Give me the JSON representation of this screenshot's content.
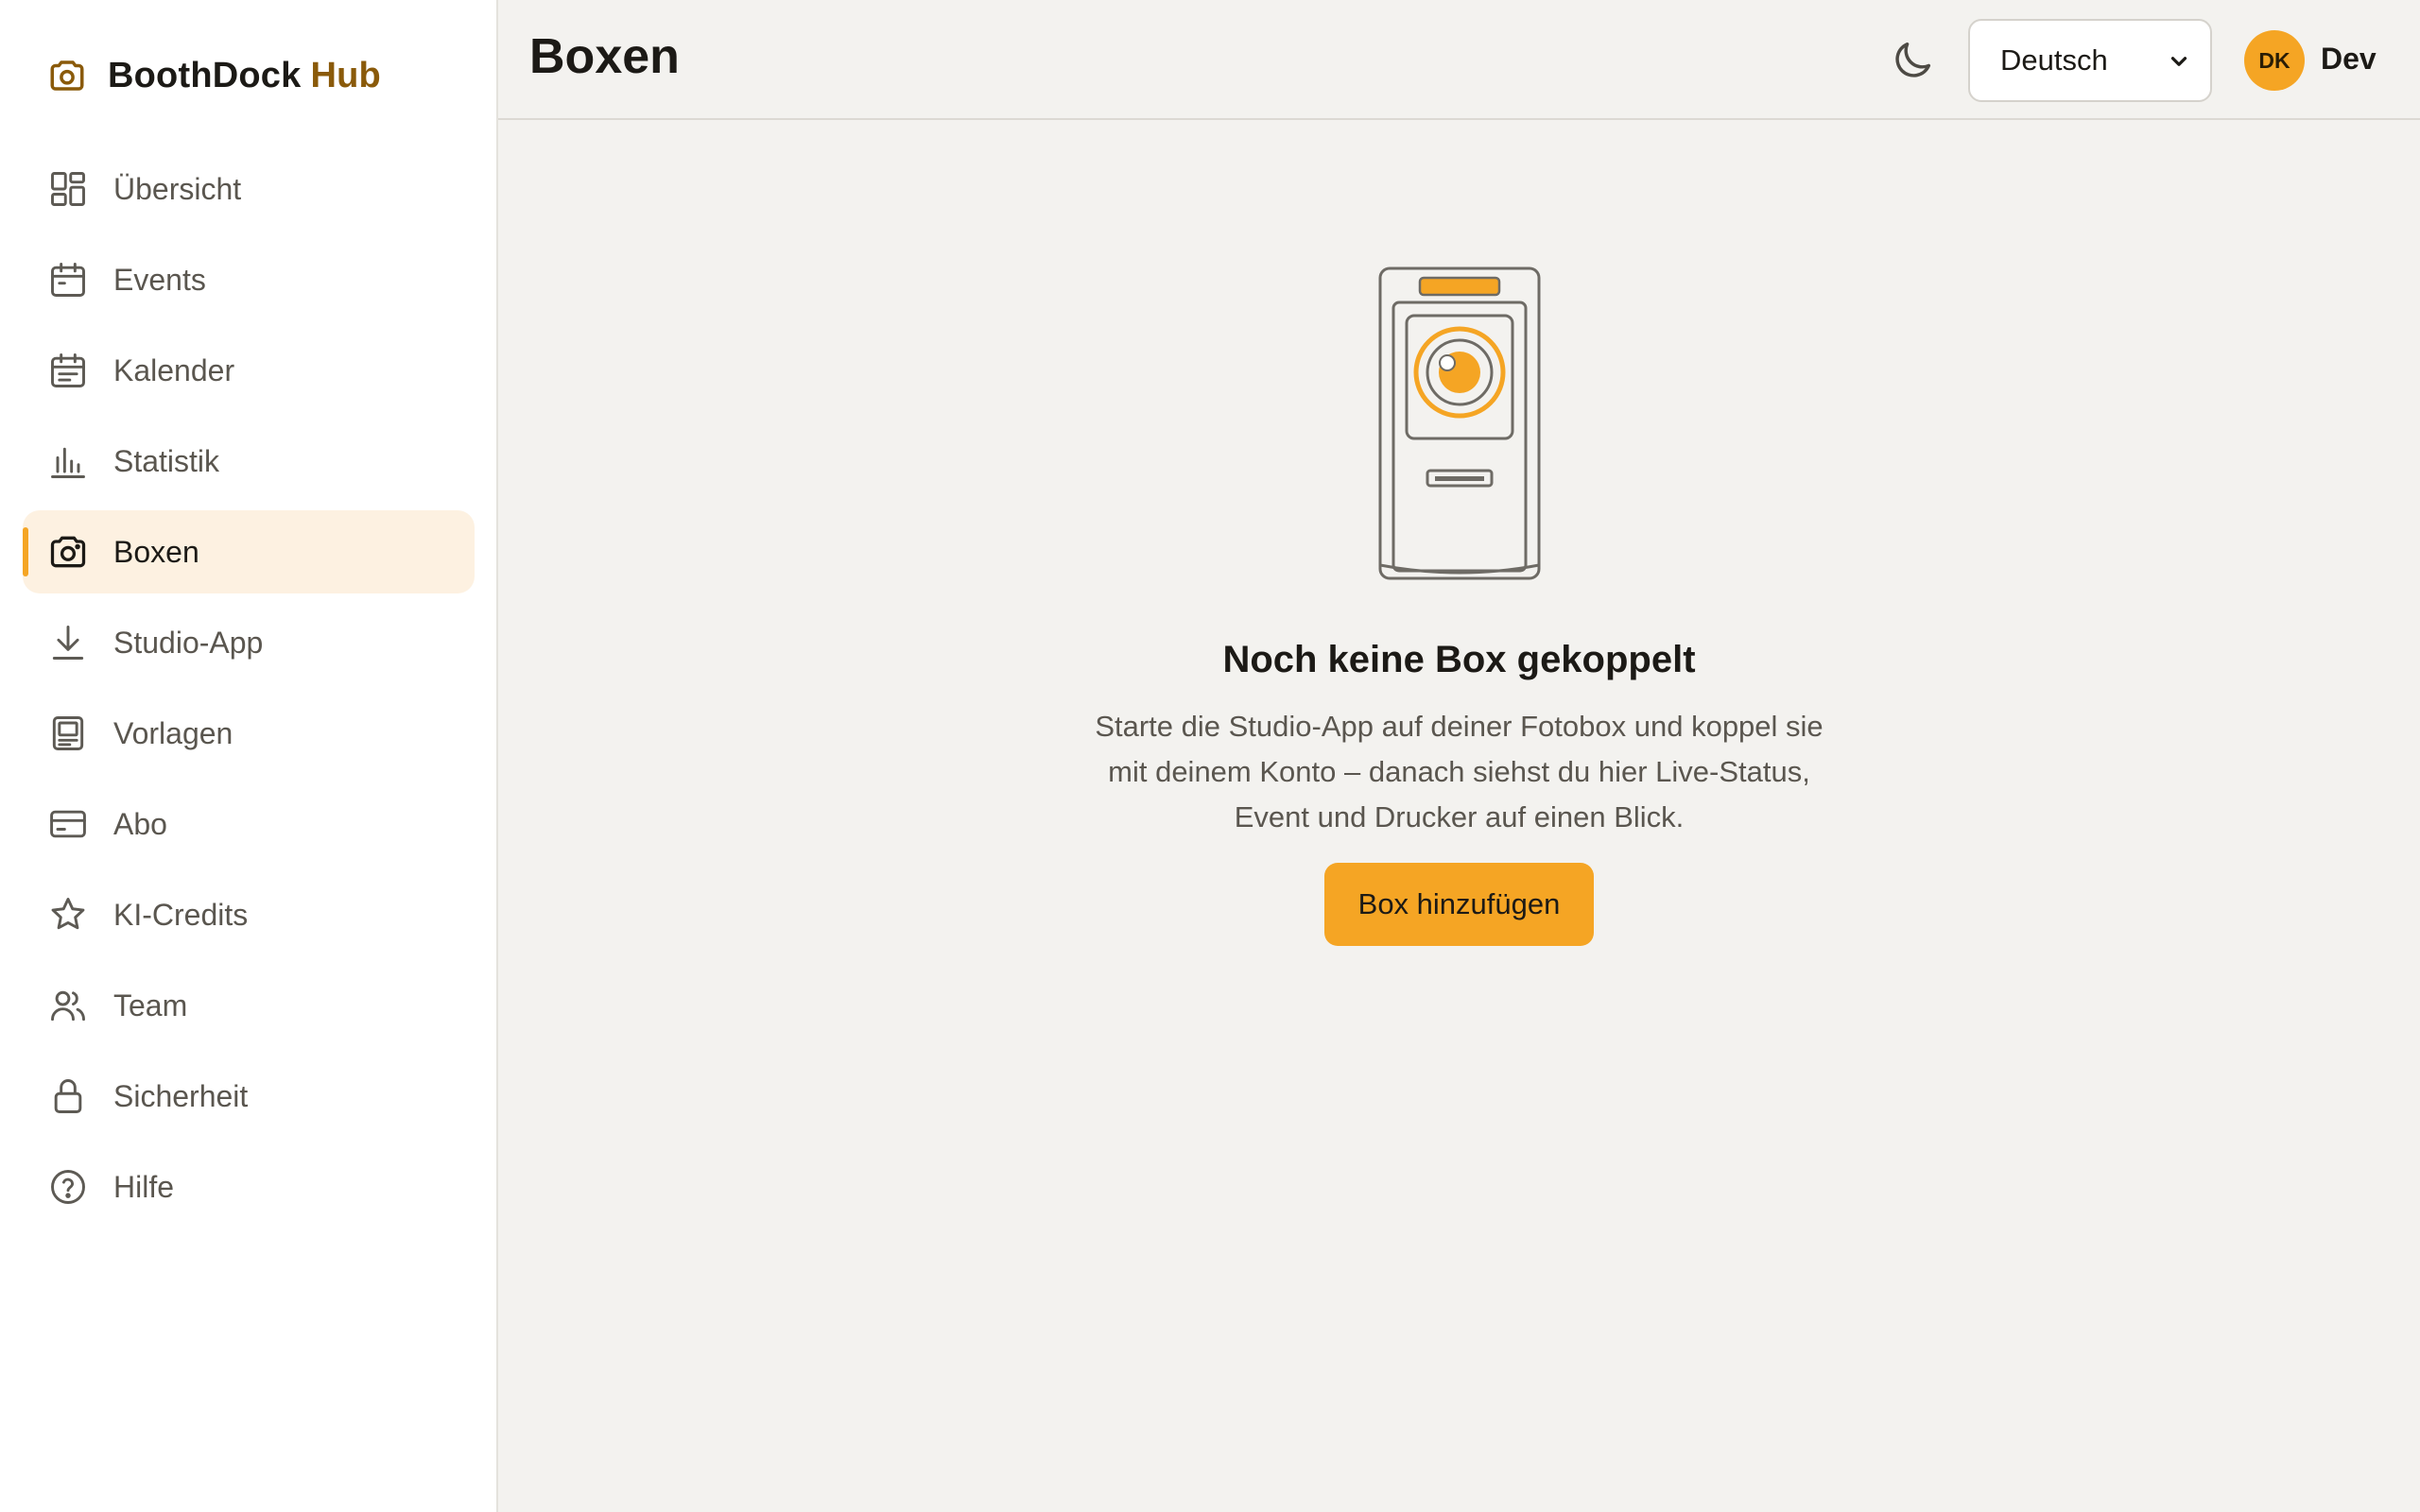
{
  "brand": {
    "name": "BoothDock",
    "accent": "Hub"
  },
  "sidebar": {
    "items": [
      {
        "label": "Übersicht",
        "icon": "dashboard-icon"
      },
      {
        "label": "Events",
        "icon": "calendar-icon"
      },
      {
        "label": "Kalender",
        "icon": "calendar-lines-icon"
      },
      {
        "label": "Statistik",
        "icon": "bar-chart-icon"
      },
      {
        "label": "Boxen",
        "icon": "camera-icon",
        "active": true
      },
      {
        "label": "Studio-App",
        "icon": "download-icon"
      },
      {
        "label": "Vorlagen",
        "icon": "template-icon"
      },
      {
        "label": "Abo",
        "icon": "credit-card-icon"
      },
      {
        "label": "KI-Credits",
        "icon": "star-icon"
      },
      {
        "label": "Team",
        "icon": "users-icon"
      },
      {
        "label": "Sicherheit",
        "icon": "lock-icon"
      },
      {
        "label": "Hilfe",
        "icon": "help-circle-icon"
      }
    ]
  },
  "header": {
    "title": "Boxen",
    "language": "Deutsch",
    "user": {
      "initials": "DK",
      "name": "Dev"
    }
  },
  "empty_state": {
    "title": "Noch keine Box gekoppelt",
    "description": "Starte die Studio-App auf deiner Fotobox und koppel sie mit deinem Konto – danach siehst du hier Live-Status, Event und Drucker auf einen Blick.",
    "button": "Box hinzufügen"
  },
  "colors": {
    "accent": "#f5a524",
    "brand_accent_text": "#8a5a0a",
    "active_bg": "#fdf1e1",
    "background": "#f3f2ef"
  }
}
